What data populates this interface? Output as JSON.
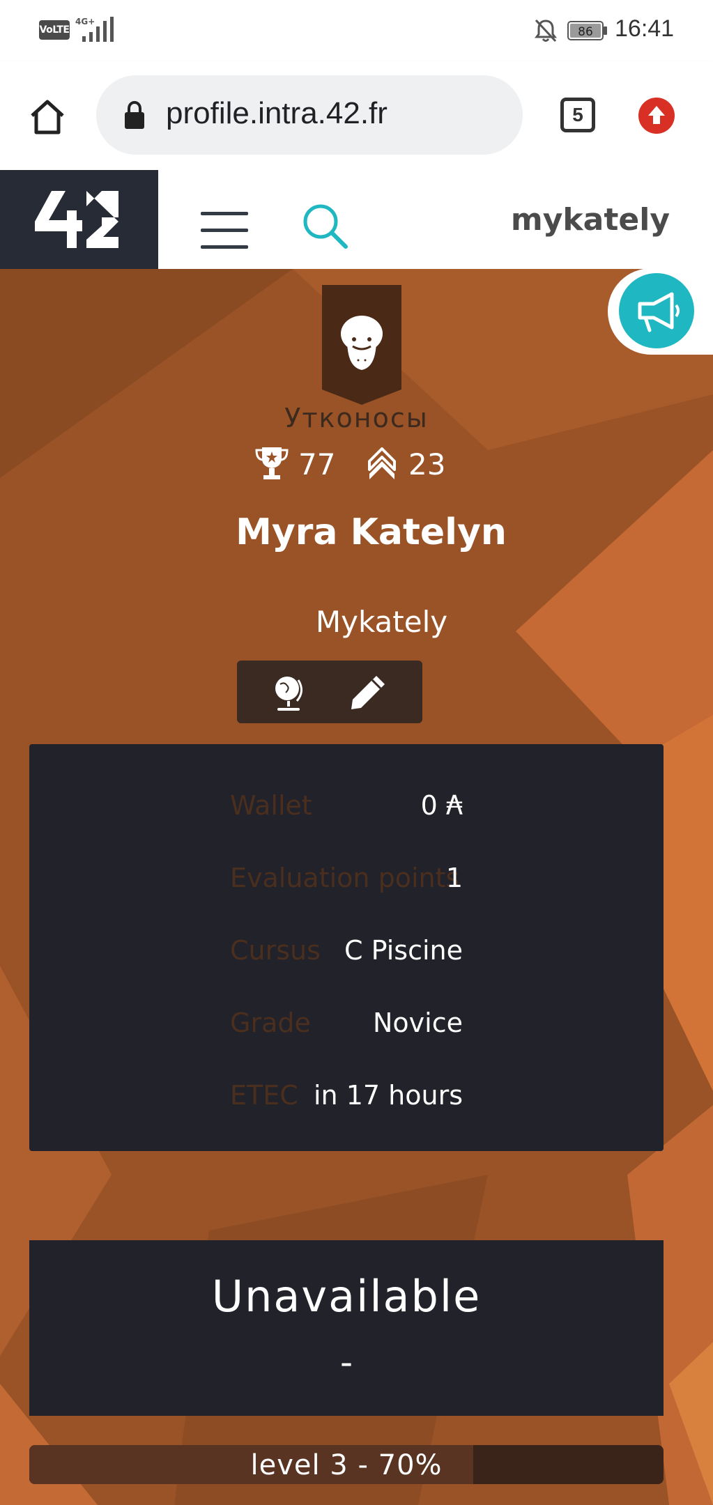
{
  "status_bar": {
    "network_badge": "VoLTE",
    "network_type": "4G+",
    "battery": "86",
    "time": "16:41"
  },
  "browser": {
    "url": "profile.intra.42.fr",
    "tab_count": "5"
  },
  "header": {
    "logo": "42",
    "username": "mykately"
  },
  "profile": {
    "coalition": "Утконосы",
    "coalition_score": "77",
    "rank": "23",
    "full_name": "Myra Katelyn",
    "login": "Mykately"
  },
  "info": {
    "rows": [
      {
        "label": "Wallet",
        "value": "0 ₳"
      },
      {
        "label": "Evaluation points",
        "value": "1"
      },
      {
        "label": "Cursus",
        "value": "C Piscine"
      },
      {
        "label": "Grade",
        "value": "Novice"
      },
      {
        "label": "ETEC",
        "value": "in 17 hours"
      }
    ]
  },
  "location": {
    "status": "Unavailable",
    "detail": "-"
  },
  "level": {
    "text": "level 3 - 70%",
    "progress_fraction": 0.7
  },
  "colors": {
    "background": "#9a5326",
    "panel": "#22222a",
    "accent": "#1fb7c1",
    "logo_bg": "#262b35"
  }
}
